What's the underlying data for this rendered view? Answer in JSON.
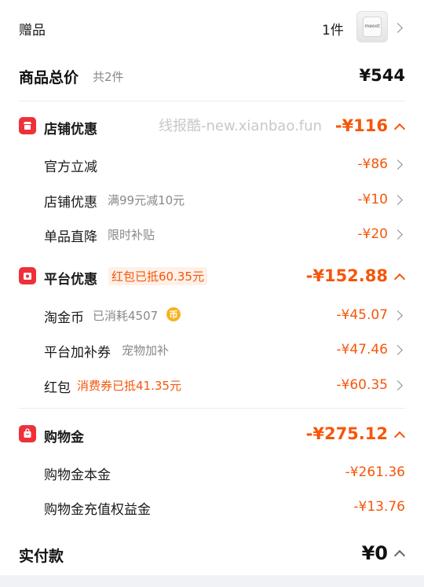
{
  "gift": {
    "label": "赠品",
    "count": "1件",
    "thumb_text": "meoot"
  },
  "total": {
    "label": "商品总价",
    "sub": "共2件",
    "amount": "¥544"
  },
  "watermark": "线报酷-new.xianbao.fun",
  "shop_discount": {
    "label": "店铺优惠",
    "amount": "-¥116",
    "items": [
      {
        "label": "官方立减",
        "note": "",
        "amount": "-¥86"
      },
      {
        "label": "店铺优惠",
        "note": "满99元减10元",
        "amount": "-¥10"
      },
      {
        "label": "单品直降",
        "note": "限时补贴",
        "amount": "-¥20"
      }
    ]
  },
  "platform_discount": {
    "label": "平台优惠",
    "tag": "红包已抵60.35元",
    "amount": "-¥152.88",
    "items": [
      {
        "label": "淘金币",
        "note": "已消耗4507",
        "amount": "-¥45.07"
      },
      {
        "label": "平台加补券",
        "note": "宠物加补",
        "amount": "-¥47.46"
      },
      {
        "label": "红包",
        "note": "消费券已抵41.35元",
        "amount": "-¥60.35"
      }
    ]
  },
  "shopping_gold": {
    "label": "购物金",
    "amount": "-¥275.12",
    "items": [
      {
        "label": "购物金本金",
        "amount": "-¥261.36"
      },
      {
        "label": "购物金充值权益金",
        "amount": "-¥13.76"
      }
    ]
  },
  "actual_pay": {
    "label": "实付款",
    "amount": "¥0"
  },
  "colors": {
    "accent": "#f5560a",
    "badge": "#ef3039",
    "coin": "#f5b321"
  },
  "icons": {
    "shop": "shop-icon",
    "platform": "coupon-icon",
    "gold": "bag-icon",
    "coin": "taojinbi-coin-icon"
  }
}
